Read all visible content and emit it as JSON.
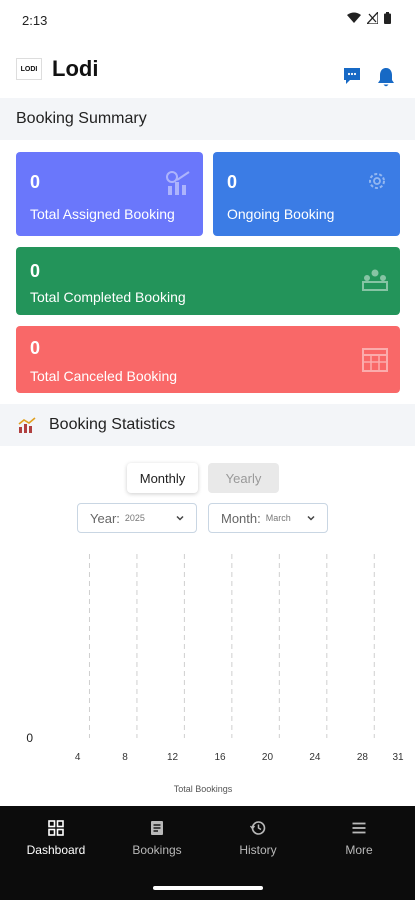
{
  "status_bar": {
    "time": "2:13"
  },
  "header": {
    "logo_text": "LODI",
    "app_name": "Lodi"
  },
  "summary": {
    "title": "Booking Summary",
    "cards": [
      {
        "value": "0",
        "label": "Total Assigned Booking",
        "color": "#6a77fb"
      },
      {
        "value": "0",
        "label": "Ongoing Booking",
        "color": "#3b7ce5"
      },
      {
        "value": "0",
        "label": "Total Completed Booking",
        "color": "#23945a"
      },
      {
        "value": "0",
        "label": "Total Canceled Booking",
        "color": "#f96868"
      }
    ]
  },
  "statistics": {
    "title": "Booking Statistics",
    "tabs": {
      "monthly": "Monthly",
      "yearly": "Yearly",
      "active": "Monthly"
    },
    "year_select": {
      "label": "Year:",
      "value": "2025"
    },
    "month_select": {
      "label": "Month:",
      "value": "March"
    }
  },
  "chart_data": {
    "type": "area",
    "x": [
      1,
      2,
      3,
      4,
      5,
      6,
      7,
      8,
      9,
      10,
      11,
      12,
      13,
      14,
      15,
      16,
      17,
      18,
      19,
      20,
      21,
      22,
      23,
      24,
      25,
      26,
      27,
      28,
      29,
      30,
      31
    ],
    "series": [
      {
        "values": [
          0,
          0,
          0,
          0,
          0,
          0,
          0,
          0,
          0,
          0,
          0,
          0,
          0,
          0,
          0,
          0,
          0,
          0,
          0,
          0,
          0,
          0,
          0,
          0,
          0,
          0,
          0,
          0,
          0,
          0,
          0
        ]
      }
    ],
    "x_tick_labels": [
      "4",
      "8",
      "12",
      "16",
      "20",
      "24",
      "28",
      "31"
    ],
    "y_tick_labels": [
      "0"
    ],
    "xlabel": "Total Bookings",
    "ylabel": "",
    "grid": "vertical dashed",
    "colors": {
      "line_start": "#f3a6a6",
      "line_end": "#9fb0d6"
    }
  },
  "bottom_nav": [
    {
      "label": "Dashboard",
      "icon": "dashboard-icon",
      "active": true
    },
    {
      "label": "Bookings",
      "icon": "bookings-icon",
      "active": false
    },
    {
      "label": "History",
      "icon": "history-icon",
      "active": false
    },
    {
      "label": "More",
      "icon": "menu-icon",
      "active": false
    }
  ],
  "colors": {
    "primary": "#1769c5",
    "section_bg": "#f3f5f8"
  }
}
